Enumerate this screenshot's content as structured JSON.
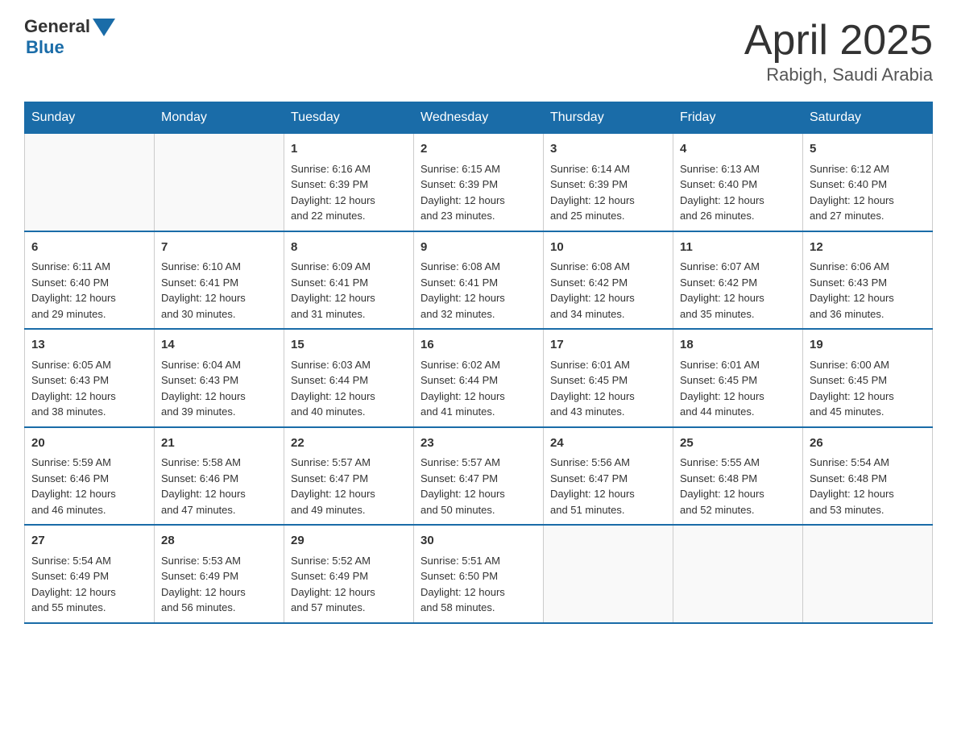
{
  "header": {
    "logo_general": "General",
    "logo_blue": "Blue",
    "month_title": "April 2025",
    "location": "Rabigh, Saudi Arabia"
  },
  "days_of_week": [
    "Sunday",
    "Monday",
    "Tuesday",
    "Wednesday",
    "Thursday",
    "Friday",
    "Saturday"
  ],
  "weeks": [
    [
      {
        "num": "",
        "info": ""
      },
      {
        "num": "",
        "info": ""
      },
      {
        "num": "1",
        "info": "Sunrise: 6:16 AM\nSunset: 6:39 PM\nDaylight: 12 hours\nand 22 minutes."
      },
      {
        "num": "2",
        "info": "Sunrise: 6:15 AM\nSunset: 6:39 PM\nDaylight: 12 hours\nand 23 minutes."
      },
      {
        "num": "3",
        "info": "Sunrise: 6:14 AM\nSunset: 6:39 PM\nDaylight: 12 hours\nand 25 minutes."
      },
      {
        "num": "4",
        "info": "Sunrise: 6:13 AM\nSunset: 6:40 PM\nDaylight: 12 hours\nand 26 minutes."
      },
      {
        "num": "5",
        "info": "Sunrise: 6:12 AM\nSunset: 6:40 PM\nDaylight: 12 hours\nand 27 minutes."
      }
    ],
    [
      {
        "num": "6",
        "info": "Sunrise: 6:11 AM\nSunset: 6:40 PM\nDaylight: 12 hours\nand 29 minutes."
      },
      {
        "num": "7",
        "info": "Sunrise: 6:10 AM\nSunset: 6:41 PM\nDaylight: 12 hours\nand 30 minutes."
      },
      {
        "num": "8",
        "info": "Sunrise: 6:09 AM\nSunset: 6:41 PM\nDaylight: 12 hours\nand 31 minutes."
      },
      {
        "num": "9",
        "info": "Sunrise: 6:08 AM\nSunset: 6:41 PM\nDaylight: 12 hours\nand 32 minutes."
      },
      {
        "num": "10",
        "info": "Sunrise: 6:08 AM\nSunset: 6:42 PM\nDaylight: 12 hours\nand 34 minutes."
      },
      {
        "num": "11",
        "info": "Sunrise: 6:07 AM\nSunset: 6:42 PM\nDaylight: 12 hours\nand 35 minutes."
      },
      {
        "num": "12",
        "info": "Sunrise: 6:06 AM\nSunset: 6:43 PM\nDaylight: 12 hours\nand 36 minutes."
      }
    ],
    [
      {
        "num": "13",
        "info": "Sunrise: 6:05 AM\nSunset: 6:43 PM\nDaylight: 12 hours\nand 38 minutes."
      },
      {
        "num": "14",
        "info": "Sunrise: 6:04 AM\nSunset: 6:43 PM\nDaylight: 12 hours\nand 39 minutes."
      },
      {
        "num": "15",
        "info": "Sunrise: 6:03 AM\nSunset: 6:44 PM\nDaylight: 12 hours\nand 40 minutes."
      },
      {
        "num": "16",
        "info": "Sunrise: 6:02 AM\nSunset: 6:44 PM\nDaylight: 12 hours\nand 41 minutes."
      },
      {
        "num": "17",
        "info": "Sunrise: 6:01 AM\nSunset: 6:45 PM\nDaylight: 12 hours\nand 43 minutes."
      },
      {
        "num": "18",
        "info": "Sunrise: 6:01 AM\nSunset: 6:45 PM\nDaylight: 12 hours\nand 44 minutes."
      },
      {
        "num": "19",
        "info": "Sunrise: 6:00 AM\nSunset: 6:45 PM\nDaylight: 12 hours\nand 45 minutes."
      }
    ],
    [
      {
        "num": "20",
        "info": "Sunrise: 5:59 AM\nSunset: 6:46 PM\nDaylight: 12 hours\nand 46 minutes."
      },
      {
        "num": "21",
        "info": "Sunrise: 5:58 AM\nSunset: 6:46 PM\nDaylight: 12 hours\nand 47 minutes."
      },
      {
        "num": "22",
        "info": "Sunrise: 5:57 AM\nSunset: 6:47 PM\nDaylight: 12 hours\nand 49 minutes."
      },
      {
        "num": "23",
        "info": "Sunrise: 5:57 AM\nSunset: 6:47 PM\nDaylight: 12 hours\nand 50 minutes."
      },
      {
        "num": "24",
        "info": "Sunrise: 5:56 AM\nSunset: 6:47 PM\nDaylight: 12 hours\nand 51 minutes."
      },
      {
        "num": "25",
        "info": "Sunrise: 5:55 AM\nSunset: 6:48 PM\nDaylight: 12 hours\nand 52 minutes."
      },
      {
        "num": "26",
        "info": "Sunrise: 5:54 AM\nSunset: 6:48 PM\nDaylight: 12 hours\nand 53 minutes."
      }
    ],
    [
      {
        "num": "27",
        "info": "Sunrise: 5:54 AM\nSunset: 6:49 PM\nDaylight: 12 hours\nand 55 minutes."
      },
      {
        "num": "28",
        "info": "Sunrise: 5:53 AM\nSunset: 6:49 PM\nDaylight: 12 hours\nand 56 minutes."
      },
      {
        "num": "29",
        "info": "Sunrise: 5:52 AM\nSunset: 6:49 PM\nDaylight: 12 hours\nand 57 minutes."
      },
      {
        "num": "30",
        "info": "Sunrise: 5:51 AM\nSunset: 6:50 PM\nDaylight: 12 hours\nand 58 minutes."
      },
      {
        "num": "",
        "info": ""
      },
      {
        "num": "",
        "info": ""
      },
      {
        "num": "",
        "info": ""
      }
    ]
  ]
}
